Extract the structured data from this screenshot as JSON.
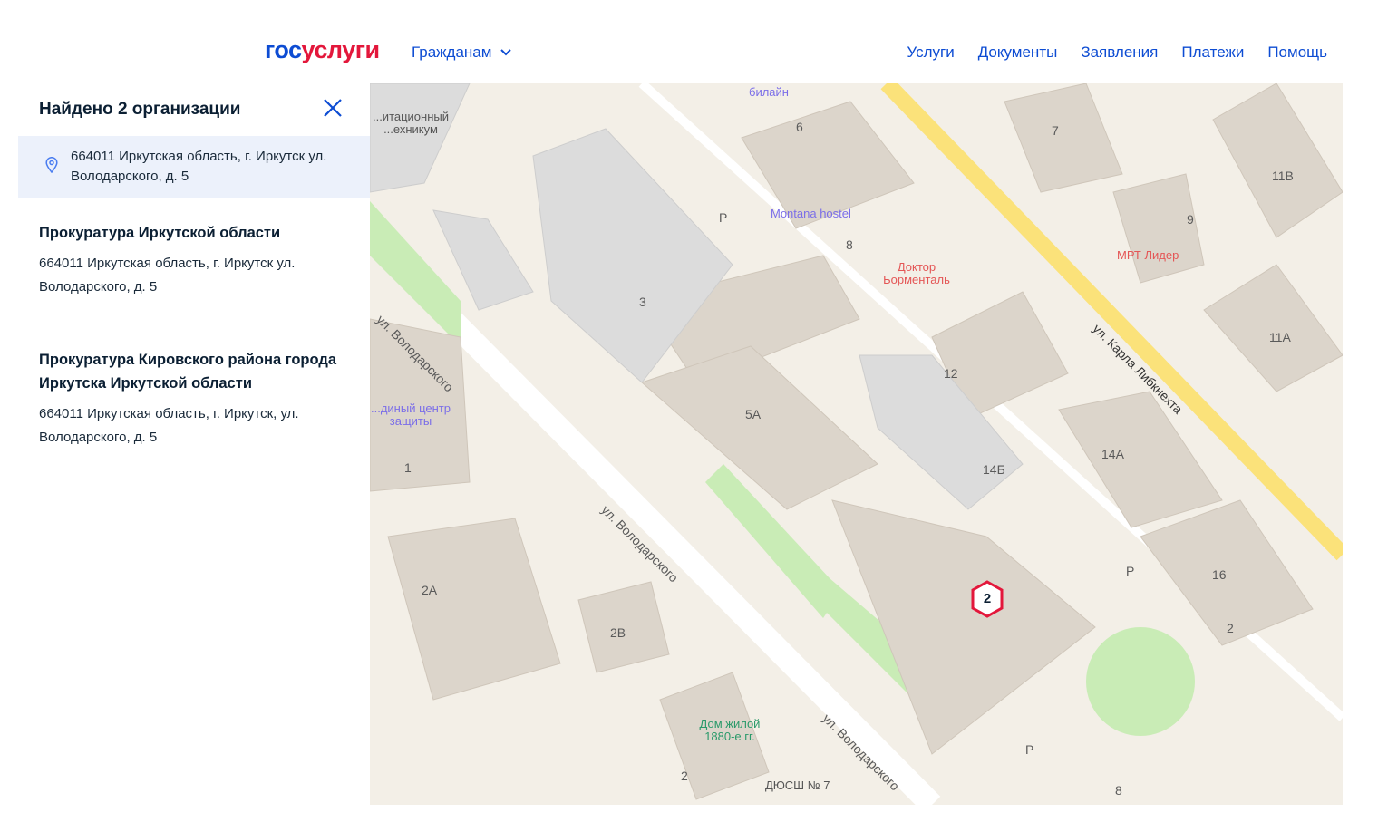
{
  "header": {
    "logo_part1": "гос",
    "logo_part2": "услуги",
    "citizens": "Гражданам",
    "nav": [
      "Услуги",
      "Документы",
      "Заявления",
      "Платежи",
      "Помощь"
    ]
  },
  "panel": {
    "title": "Найдено 2 организации",
    "selected_address": "664011 Иркутская область, г. Иркутск ул. Володарского, д. 5",
    "orgs": [
      {
        "name": "Прокуратура Иркутской области",
        "address": "664011 Иркутская область, г. Иркутск ул. Володарского, д. 5"
      },
      {
        "name": "Прокуратура Кировского района города Иркутска Иркутской области",
        "address": "664011 Иркутская область, г. Иркутск, ул. Володарского, д. 5"
      }
    ]
  },
  "map": {
    "marker_count": "2",
    "streets": [
      "ул. Володарского",
      "ул. Володарского",
      "ул. Володарского",
      "ул. Карла Либкнехта"
    ],
    "buildings": [
      "6",
      "7",
      "11В",
      "9",
      "8",
      "3",
      "11А",
      "12",
      "5А",
      "14Б",
      "14А",
      "16",
      "2А",
      "2В",
      "2",
      "1",
      "2",
      "8",
      "P",
      "P",
      "P"
    ],
    "pois": [
      "билайн",
      "Montana hostel",
      "Доктор Борменталь",
      "МРТ Лидер",
      "Дом жилой 1880-е гг.",
      "ДЮСШ № 7",
      "...итационный ...ехникум",
      "...диный центр защиты"
    ]
  }
}
